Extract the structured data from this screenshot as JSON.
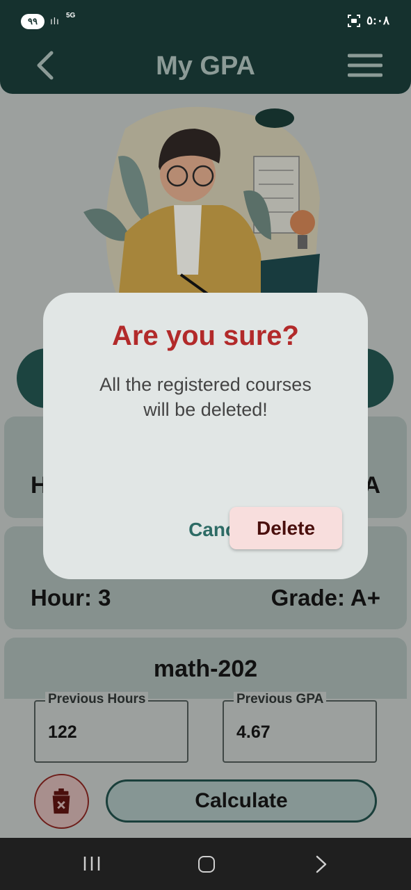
{
  "status_bar": {
    "battery": "٩٩",
    "network": "5G",
    "time": "٥:٠٨"
  },
  "app_bar": {
    "title": "My GPA"
  },
  "course_cards": [
    {
      "left_text": "H",
      "right_text": "A"
    },
    {
      "hour": "Hour: 3",
      "grade": "Grade: A+"
    },
    {
      "name": "math-202"
    }
  ],
  "fields": {
    "previous_hours_label": "Previous Hours",
    "previous_hours_value": "122",
    "previous_gpa_label": "Previous GPA",
    "previous_gpa_value": "4.67"
  },
  "calculate_label": "Calculate",
  "dialog": {
    "title": "Are you sure?",
    "message": "All the registered courses will be deleted!",
    "cancel_label": "Cancel",
    "delete_label": "Delete"
  },
  "colors": {
    "app_bar": "#15312e",
    "dialog_title": "#b22a2a",
    "cancel_text": "#2d6b65",
    "delete_bg": "#f8dedd"
  }
}
